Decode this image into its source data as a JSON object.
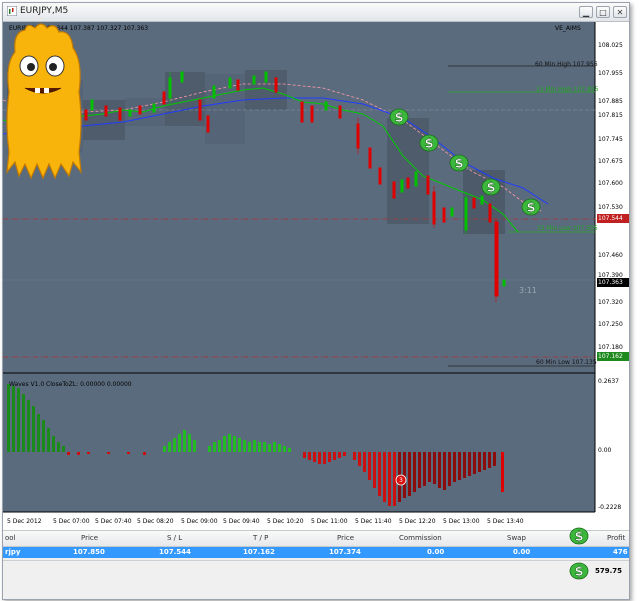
{
  "window": {
    "title": "EURJPY,M5",
    "controls": {
      "minimize": "▁",
      "maximize": "□",
      "close": "✕"
    }
  },
  "chart": {
    "header_left": "EURJPY,M5  107.344 107.387 107.327 107.363",
    "header_right": "VE_AIMS",
    "countdown": "3:11",
    "levels": {
      "h60_high": "60 Min High   107.956",
      "m15_high": "15 Min High   107.855",
      "m15_low": "15 Min Low   107.505",
      "h60_low": "60 Min Low   107.135"
    },
    "price_axis": [
      "108.025",
      "107.955",
      "107.885",
      "107.815",
      "107.745",
      "107.675",
      "107.600",
      "107.530",
      "107.460",
      "107.390",
      "107.320",
      "107.250",
      "107.180"
    ],
    "price_tags": {
      "red": "107.544",
      "current": "107.363",
      "green": "107.162"
    },
    "oscillator": {
      "header": "Waves V1.0 CloseToZL: 0.00000 0.00000",
      "axis_top": "0.2637",
      "axis_mid": "0.00",
      "axis_bottom": "-0.2228",
      "marker": "3"
    },
    "time_axis": [
      "5 Dec 2012",
      "5 Dec 07:00",
      "5 Dec 07:40",
      "5 Dec 08:20",
      "5 Dec 09:00",
      "5 Dec 09:40",
      "5 Dec 10:20",
      "5 Dec 11:00",
      "5 Dec 11:40",
      "5 Dec 12:20",
      "5 Dec 13:00",
      "5 Dec 13:40"
    ],
    "colors": {
      "background": "#5b6b7e",
      "bull": "#00c000",
      "bear": "#e00000",
      "ema_fast": "#00c800",
      "ema_slow": "#1f3cff",
      "ema_pink": "#ff9aa8"
    },
    "icons": [
      "dollar-icon",
      "monster-mascot-icon"
    ]
  },
  "trade_table": {
    "headers": [
      "ool",
      "Price",
      "S / L",
      "T / P",
      "Price",
      "Commission",
      "Swap",
      "Profit"
    ],
    "row": [
      "rjpy",
      "107.850",
      "107.544",
      "107.162",
      "107.374",
      "0.00",
      "0.00",
      "476"
    ],
    "balance": "579.75"
  }
}
